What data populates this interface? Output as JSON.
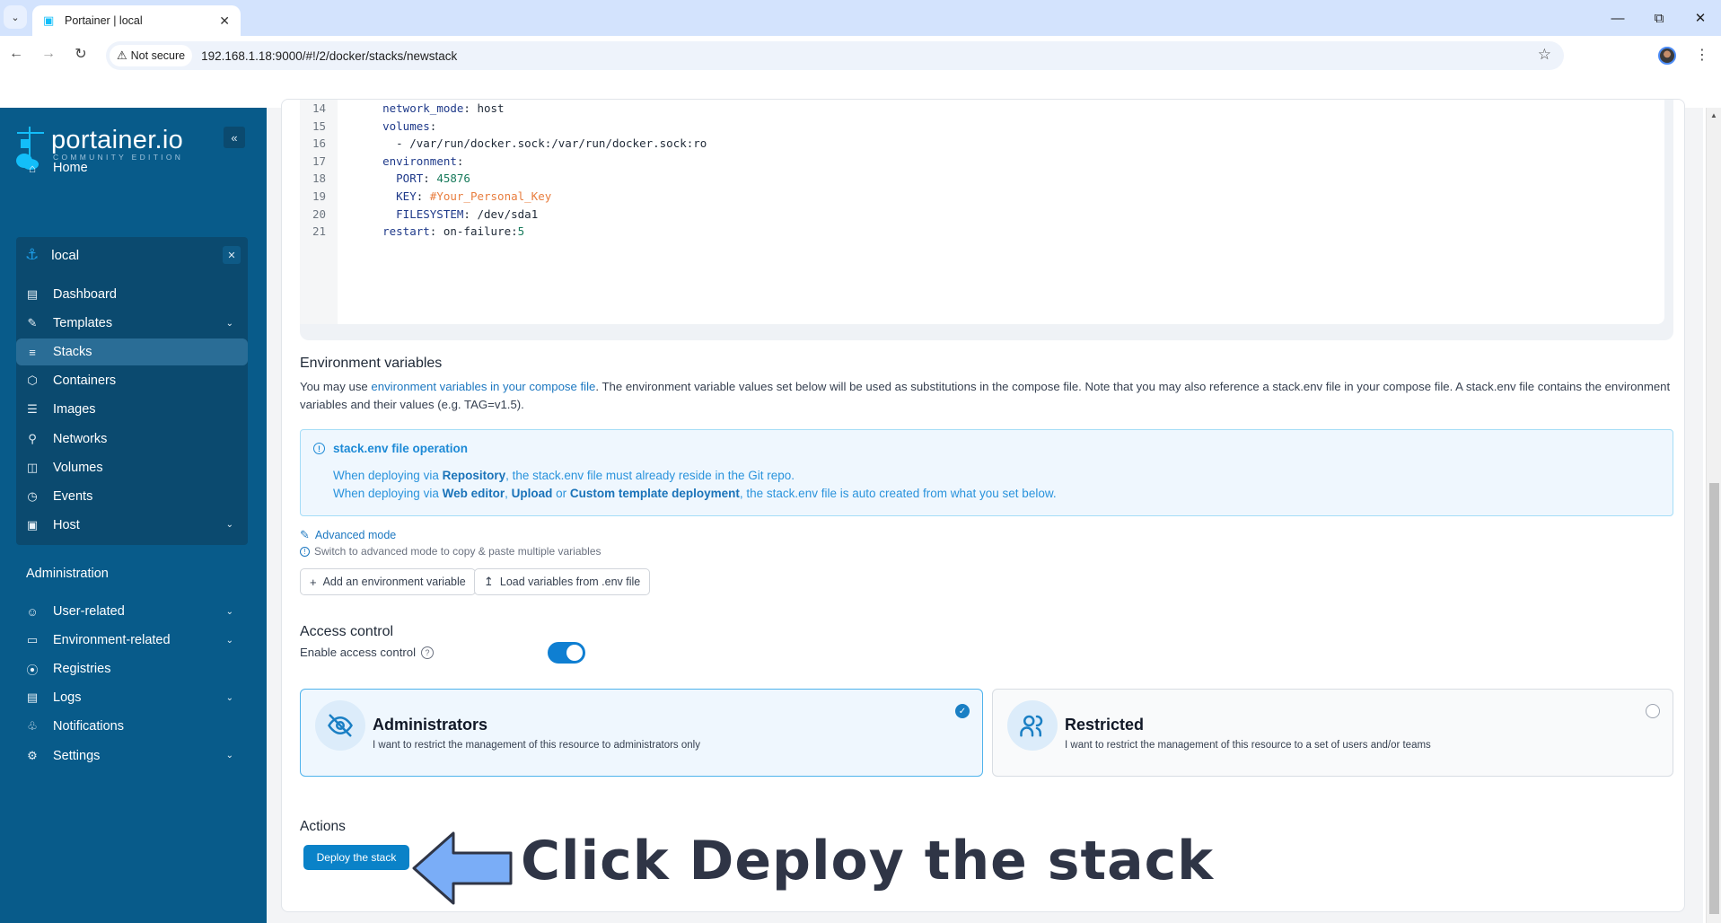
{
  "browser": {
    "tab_title": "Portainer | local",
    "security_label": "Not secure",
    "url": "192.168.1.18:9000/#!/2/docker/stacks/newstack",
    "window_controls": [
      "minimize",
      "restore",
      "close"
    ]
  },
  "sidebar": {
    "brand": "portainer.io",
    "edition": "COMMUNITY EDITION",
    "home": "Home",
    "environment": {
      "name": "local",
      "items": [
        {
          "label": "Dashboard",
          "icon": "layout-icon",
          "has_chevron": false
        },
        {
          "label": "Templates",
          "icon": "edit-icon",
          "has_chevron": true
        },
        {
          "label": "Stacks",
          "icon": "layers-icon",
          "has_chevron": false,
          "active": true
        },
        {
          "label": "Containers",
          "icon": "box-icon",
          "has_chevron": false
        },
        {
          "label": "Images",
          "icon": "list-icon",
          "has_chevron": false
        },
        {
          "label": "Networks",
          "icon": "network-icon",
          "has_chevron": false
        },
        {
          "label": "Volumes",
          "icon": "database-icon",
          "has_chevron": false
        },
        {
          "label": "Events",
          "icon": "clock-icon",
          "has_chevron": false
        },
        {
          "label": "Host",
          "icon": "server-icon",
          "has_chevron": true
        }
      ]
    },
    "admin_title": "Administration",
    "admin_items": [
      {
        "label": "User-related",
        "icon": "users-icon",
        "has_chevron": true
      },
      {
        "label": "Environment-related",
        "icon": "hard-drive-icon",
        "has_chevron": true
      },
      {
        "label": "Registries",
        "icon": "radio-icon",
        "has_chevron": false
      },
      {
        "label": "Logs",
        "icon": "file-text-icon",
        "has_chevron": true
      },
      {
        "label": "Notifications",
        "icon": "bell-icon",
        "has_chevron": false
      },
      {
        "label": "Settings",
        "icon": "settings-icon",
        "has_chevron": true
      }
    ]
  },
  "editor": {
    "lines": [
      {
        "n": "14",
        "indent": "    ",
        "key": "network_mode",
        "value": "host",
        "vclass": ""
      },
      {
        "n": "15",
        "indent": "    ",
        "key": "volumes",
        "value": "",
        "vclass": ""
      },
      {
        "n": "16",
        "indent": "      ",
        "key": "",
        "value": "- /var/run/docker.sock:/var/run/docker.sock:ro",
        "vclass": ""
      },
      {
        "n": "17",
        "indent": "    ",
        "key": "environment",
        "value": "",
        "vclass": ""
      },
      {
        "n": "18",
        "indent": "      ",
        "key": "PORT",
        "value": "45876",
        "vclass": "num"
      },
      {
        "n": "19",
        "indent": "      ",
        "key": "KEY",
        "value": "#Your_Personal_Key",
        "vclass": "str-orange"
      },
      {
        "n": "20",
        "indent": "      ",
        "key": "FILESYSTEM",
        "value": "/dev/sda1",
        "vclass": ""
      },
      {
        "n": "21",
        "indent": "    ",
        "key": "restart",
        "value": "on-failure:5",
        "vclass": "restart"
      }
    ]
  },
  "env_vars": {
    "title": "Environment variables",
    "para_before_link": "You may use ",
    "para_link": "environment variables in your compose file",
    "para_after_link": ". The environment variable values set below will be used as substitutions in the compose file. Note that you may also reference a stack.env file in your compose file. A stack.env file contains the environment variables and their values (e.g. TAG=v1.5).",
    "info_title": "stack.env file operation",
    "info_line1": {
      "a": "When deploying via ",
      "b1": "Repository",
      "c": ", the stack.env file must already reside in the Git repo."
    },
    "info_line2": {
      "a": "When deploying via ",
      "b1": "Web editor",
      "c1": ", ",
      "b2": "Upload",
      "c2": " or ",
      "b3": "Custom template deployment",
      "c3": ", the stack.env file is auto created from what you set below."
    },
    "advanced_mode": "Advanced mode",
    "advanced_hint": "Switch to advanced mode to copy & paste multiple variables",
    "add_button": "Add an environment variable",
    "load_button": "Load variables from .env file"
  },
  "access_control": {
    "title": "Access control",
    "toggle_label": "Enable access control",
    "toggle_on": true,
    "options": [
      {
        "title": "Administrators",
        "desc": "I want to restrict the management of this resource to administrators only",
        "selected": true
      },
      {
        "title": "Restricted",
        "desc": "I want to restrict the management of this resource to a set of users and/or teams",
        "selected": false
      }
    ]
  },
  "actions": {
    "title": "Actions",
    "deploy_button": "Deploy the stack"
  },
  "annotation": {
    "text": "Click Deploy the stack"
  },
  "colors": {
    "sidebar_bg": "#085b8a",
    "accent": "#0a82c8",
    "annotation_arrow": "#7aadf7"
  }
}
